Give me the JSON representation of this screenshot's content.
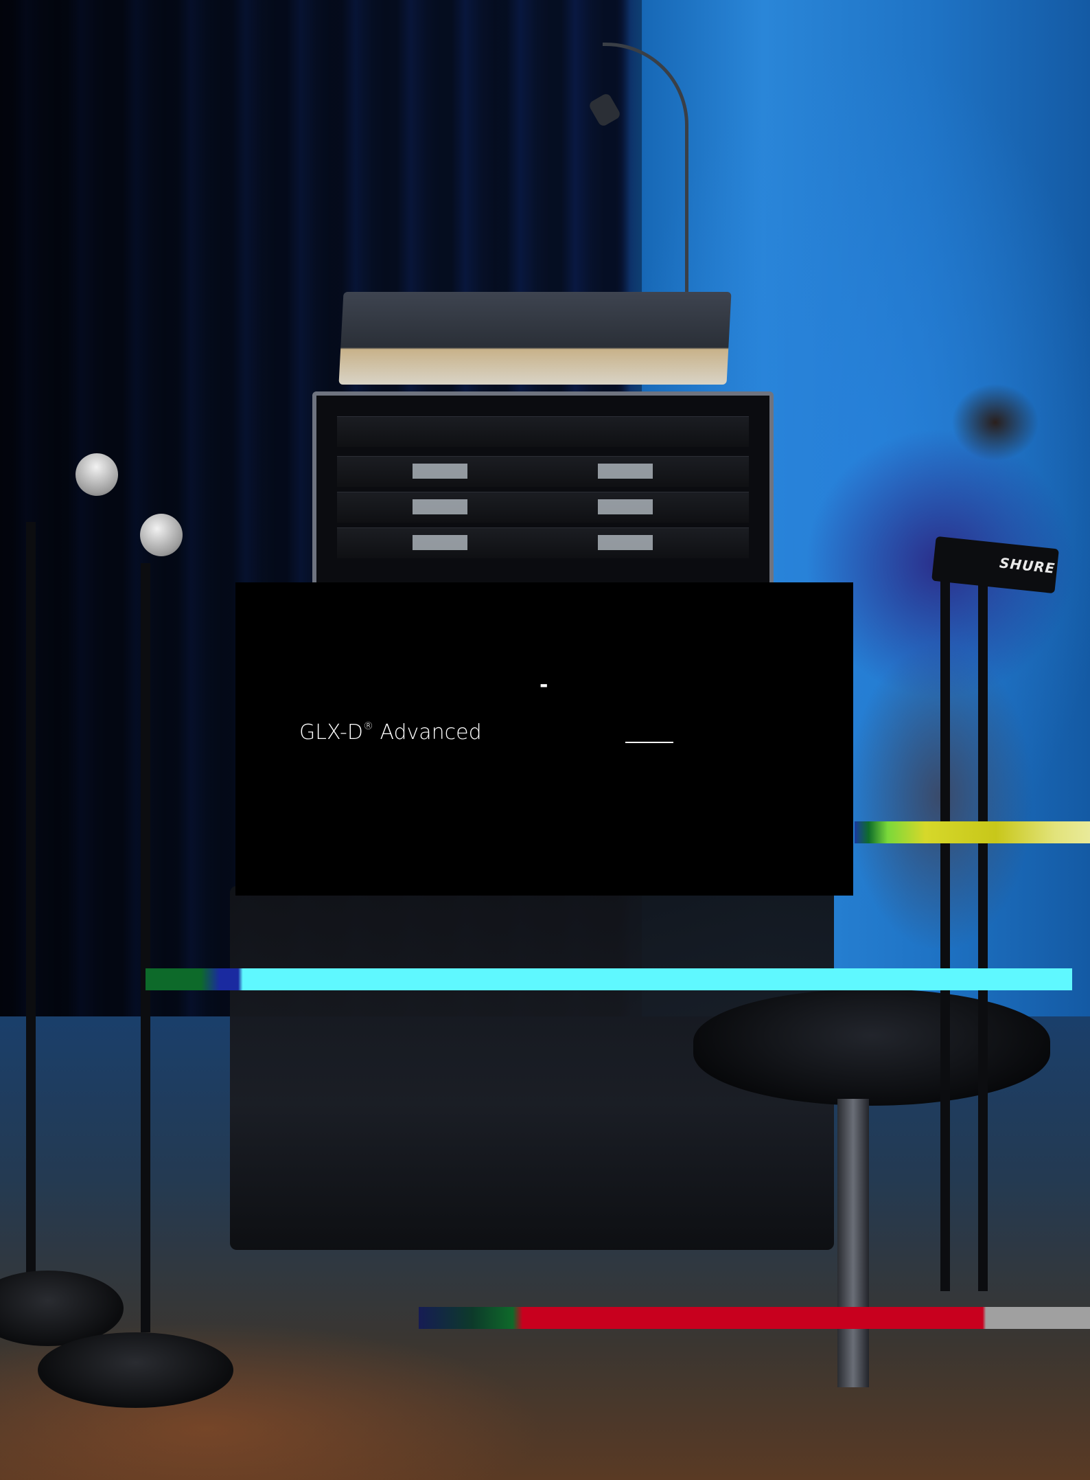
{
  "card": {
    "title_prefix": "GLX-D",
    "title_mark": "®",
    "title_suffix": " Advanced",
    "dash": "-"
  },
  "photo": {
    "logo_text": "SHURE"
  },
  "colors": {
    "card_background": "#000000",
    "card_text": "#ffffff",
    "glitch_cyan": "#5ff8ff",
    "glitch_red": "#c8001e",
    "glitch_yellow": "#d6d82a"
  }
}
